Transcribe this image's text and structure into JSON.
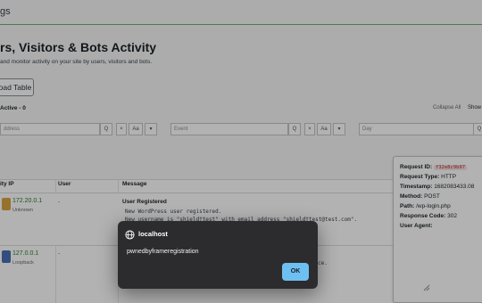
{
  "window": {
    "title": "gs"
  },
  "page": {
    "title": "rs, Visitors & Bots Activity",
    "subtitle": "and monitor activity on your site by users, visitors and bots.",
    "load_table_label": "oad Table",
    "active_label": "Active - 0",
    "collapse_all": "Collapse All",
    "show": "Show"
  },
  "filters": [
    {
      "placeholder": "ddress"
    },
    {
      "placeholder": "Event"
    },
    {
      "placeholder": "Day"
    }
  ],
  "filter_buttons": {
    "search": "Q",
    "clear": "×",
    "sort": "Aa",
    "menu": "▾",
    "trailing": "Q"
  },
  "table": {
    "headers": [
      "ity IP",
      "User",
      "Message"
    ],
    "rows": [
      {
        "ip": "172.20.0.1",
        "ip_label": "Unknown",
        "user": "-",
        "message_title": "User Registered",
        "message_lines": [
          "New WordPress user registered.",
          "New username is \"shield†test\" with email address \"shield†test@test.com\"."
        ]
      },
      {
        "ip": "127.0.0.1",
        "ip_label": "Loopback",
        "user": "-",
        "message_tail": "ce."
      }
    ]
  },
  "request_panel": {
    "request_id_label": "Request ID:",
    "request_id": "f32e8c9b97",
    "request_type_label": "Request Type:",
    "request_type": "HTTP",
    "timestamp_label": "Timestamp:",
    "timestamp": "1682083433.08",
    "method_label": "Method:",
    "method": "POST",
    "path_label": "Path:",
    "path": "/wp-login.php",
    "response_label": "Response Code:",
    "response": "302",
    "user_agent_label": "User Agent:"
  },
  "dialog": {
    "origin": "localhost",
    "message": "pwnedbyframeregistration",
    "ok_label": "OK"
  },
  "colors": {
    "ip_green": "#2a7d2a",
    "ok_button": "#6ec0f2",
    "dialog_bg": "#2c2c2e"
  }
}
